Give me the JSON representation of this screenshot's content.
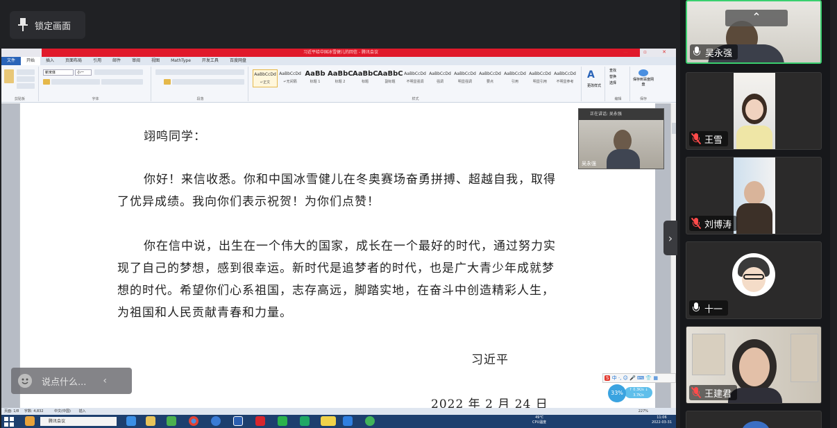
{
  "meeting": {
    "lock_label": "锁定画面",
    "chat_placeholder": "说点什么...",
    "up_arrow": "⌃",
    "collapse_arrow": "›"
  },
  "word": {
    "title": "习近平给中国冰雪健儿的回信 - 腾讯会议",
    "tabs": [
      "文件",
      "开始",
      "插入",
      "页面布局",
      "引用",
      "邮件",
      "审阅",
      "视图",
      "MathType",
      "开发工具",
      "百度网盘"
    ],
    "active_tab": "开始",
    "font_name": "新宋体",
    "font_size": "小一",
    "group_labels": [
      "剪贴板",
      "字体",
      "段落",
      "样式",
      "编辑",
      "保存"
    ],
    "styles": [
      {
        "preview": "AaBbCcDd",
        "label": "↵正文"
      },
      {
        "preview": "AaBbCcDd",
        "label": "↵无间隔"
      },
      {
        "preview": "AaBb",
        "label": "标题 1"
      },
      {
        "preview": "AaBbC",
        "label": "标题 2"
      },
      {
        "preview": "AaBbC",
        "label": "标题"
      },
      {
        "preview": "AaBbC",
        "label": "副标题"
      },
      {
        "preview": "AaBbCcDd",
        "label": "不明显强调"
      },
      {
        "preview": "AaBbCcDd",
        "label": "强调"
      },
      {
        "preview": "AaBbCcDd",
        "label": "明显强调"
      },
      {
        "preview": "AaBbCcDd",
        "label": "要点"
      },
      {
        "preview": "AaBbCcDd",
        "label": "引用"
      },
      {
        "preview": "AaBbCcDd",
        "label": "明显引用"
      },
      {
        "preview": "AaBbCcDd",
        "label": "不明显参考"
      }
    ],
    "change_styles": "更改样式",
    "edit_items": [
      "查找",
      "替换",
      "选择"
    ],
    "save_label": "保存到百度网盘",
    "document": {
      "salutation": "翊鸣同学：",
      "para1": "你好！来信收悉。你和中国冰雪健儿在冬奥赛场奋勇拼搏、超越自我，取得了优异成绩。我向你们表示祝贺！为你们点赞！",
      "para2": "你在信中说，出生在一个伟大的国家，成长在一个最好的时代，通过努力实现了自己的梦想，感到很幸运。新时代是追梦者的时代，也是广大青少年成就梦想的时代。希望你们心系祖国，志存高远，脚踏实地，在奋斗中创造精彩人生，为祖国和人民贡献青春和力量。",
      "signature": "习近平",
      "date": "2022 年 2 月 24 日"
    },
    "status": {
      "page": "页面: 1/8",
      "words": "字数: 4,832",
      "lang": "中文(中国)",
      "mode": "插入",
      "zoom": "227%"
    },
    "taskbar": {
      "search": "腾讯会议",
      "cpu_temp": "49℃",
      "cpu_label": "CPU温度",
      "time": "11:06",
      "date": "2022-03-31"
    },
    "ime_text": "中 ·, ☺ 🎤 ⌨ 👕 ▦",
    "net_percent": "33%",
    "net_speed": "↑ 0.3K/s ↓ 3.7K/s"
  },
  "speaker_video": {
    "header": "正在讲话: 吴永强",
    "name": "吴永强"
  },
  "participants": [
    {
      "name": "吴永强",
      "muted": false,
      "active": true
    },
    {
      "name": "王雪",
      "muted": true,
      "active": false
    },
    {
      "name": "刘博涛",
      "muted": true,
      "active": false
    },
    {
      "name": "十一",
      "muted": false,
      "active": false
    },
    {
      "name": "王建君",
      "muted": true,
      "active": false
    }
  ],
  "colors": {
    "meeting_bg": "#202124",
    "active_border": "#3ad06f",
    "mute_red": "#ff4a4a",
    "word_title_red": "#e0192b"
  }
}
